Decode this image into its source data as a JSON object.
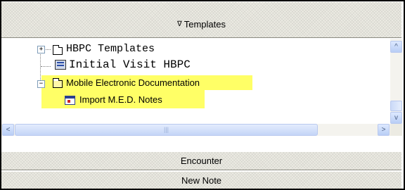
{
  "header": {
    "title": "Templates",
    "collapse_glyph": "∇"
  },
  "tree": {
    "items": [
      {
        "label": "HBPC Templates",
        "expander": "+",
        "icon": "folder-icon"
      },
      {
        "label": "Initial Visit HBPC",
        "icon": "template-document-icon"
      },
      {
        "label": "Mobile Electronic Documentation",
        "expander": "−",
        "icon": "open-folder-icon",
        "highlight_color": "#ffff66"
      },
      {
        "label": "Import M.E.D. Notes",
        "icon": "med-note-icon"
      }
    ]
  },
  "scrollbars": {
    "up_glyph": "^",
    "down_glyph": "v",
    "left_glyph": "<",
    "right_glyph": ">",
    "grip": "|||"
  },
  "footer": {
    "encounter_label": "Encounter",
    "new_note_label": "New Note"
  }
}
